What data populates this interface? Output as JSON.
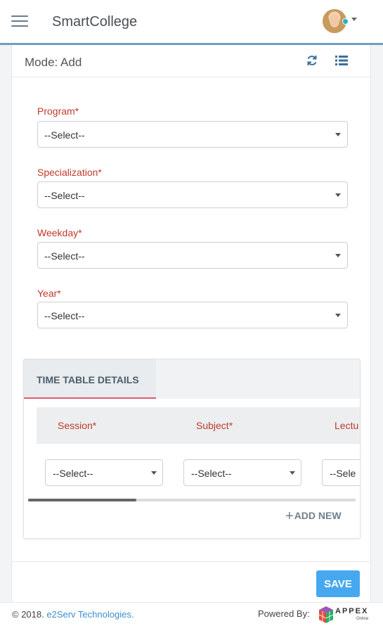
{
  "header": {
    "app_title": "SmartCollege",
    "menu_icon": "hamburger-menu-icon",
    "avatar_icon": "user-avatar",
    "status_color": "#1fb6c8"
  },
  "card": {
    "mode_label": "Mode: Add",
    "refresh_icon": "refresh-icon",
    "list_icon": "list-view-icon"
  },
  "form": {
    "program_label": "Program*",
    "program_value": "--Select--",
    "specialization_label": "Specialization*",
    "specialization_value": "--Select--",
    "weekday_label": "Weekday*",
    "weekday_value": "--Select--",
    "year_label": "Year*",
    "year_value": "--Select--"
  },
  "timetable": {
    "tab_label": "TIME TABLE DETAILS",
    "columns": [
      "Session*",
      "Subject*",
      "Lectu"
    ],
    "row": [
      "--Select--",
      "--Select--",
      "--Sele"
    ],
    "add_new_label": "ADD NEW",
    "scroll_position": 0.33
  },
  "actions": {
    "save_label": "SAVE",
    "accent_color": "#46a8ef"
  },
  "footer": {
    "copyright_prefix": "© 2018.",
    "company_link": "e2Serv Technologies.",
    "powered_by": "Powered By:",
    "brand_name": "APPEX",
    "brand_sub": "Online"
  }
}
